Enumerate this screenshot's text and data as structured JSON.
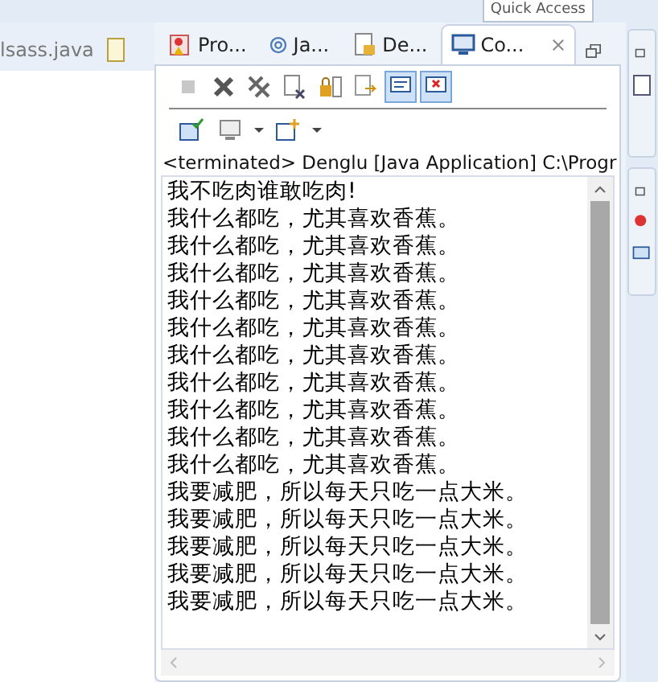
{
  "top_bar": {
    "quick_access": "Quick Access"
  },
  "editor": {
    "tab": "lsass.java"
  },
  "view_tabs": [
    {
      "label": "Pro...",
      "selected": false
    },
    {
      "label": "Ja...",
      "selected": false
    },
    {
      "label": "De...",
      "selected": false
    },
    {
      "label": "Co...",
      "selected": true
    }
  ],
  "toolbar": [
    {
      "on": false,
      "disabled": true
    },
    {
      "on": false,
      "disabled": false
    },
    {
      "on": false,
      "disabled": false
    },
    {
      "on": false,
      "disabled": false
    },
    {
      "on": false,
      "disabled": false
    },
    {
      "on": false,
      "disabled": false
    },
    {
      "on": true,
      "disabled": false
    },
    {
      "on": true,
      "disabled": false
    }
  ],
  "console": {
    "header": "<terminated> Denglu [Java Application] C:\\Progr",
    "lines": [
      "我不吃肉谁敢吃肉!",
      "我什么都吃，尤其喜欢香蕉。",
      "我什么都吃，尤其喜欢香蕉。",
      "我什么都吃，尤其喜欢香蕉。",
      "我什么都吃，尤其喜欢香蕉。",
      "我什么都吃，尤其喜欢香蕉。",
      "我什么都吃，尤其喜欢香蕉。",
      "我什么都吃，尤其喜欢香蕉。",
      "我什么都吃，尤其喜欢香蕉。",
      "我什么都吃，尤其喜欢香蕉。",
      "我什么都吃，尤其喜欢香蕉。",
      "我要减肥，所以每天只吃一点大米。",
      "我要减肥，所以每天只吃一点大米。",
      "我要减肥，所以每天只吃一点大米。",
      "我要减肥，所以每天只吃一点大米。",
      "我要减肥，所以每天只吃一点大米。"
    ]
  }
}
